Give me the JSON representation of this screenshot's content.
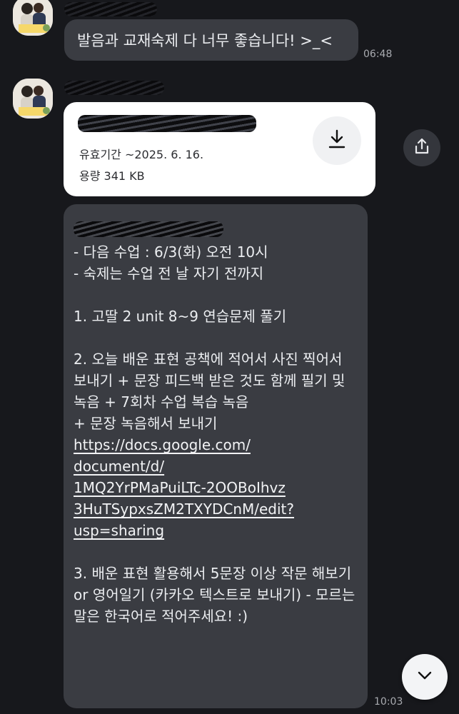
{
  "message1": {
    "text": "발음과 교재숙제 다 너무 좋습니다! >_<",
    "time": "06:48"
  },
  "file_card": {
    "expiry": "유효기간 ~2025. 6. 16.",
    "size": "용량 341 KB",
    "download_icon": "download-icon"
  },
  "share_icon": "share-icon",
  "message2": {
    "lines": [
      "- 다음 수업 : 6/3(화) 오전 10시",
      "- 숙제는 수업 전 날 자기 전까지",
      "",
      "1. 고딸 2 unit 8~9 연습문제 풀기",
      "",
      "2. 오늘 배운 표현 공책에 적어서 사진 찍어서 보내기 + 문장 피드백 받은 것도 함께 필기 및 녹음 + 7회차 수업 복습 녹음",
      "+ 문장 녹음해서 보내기"
    ],
    "link": "https://docs.google.com/document/d/1MQ2YrPMaPuiLTc-2OOBoIhvz3HuTSypxsZM2TXYDCnM/edit?usp=sharing",
    "link_lines": [
      "https://docs.google.com/",
      "document/d/",
      "1MQ2YrPMaPuiLTc-2OOBoIhvz",
      "3HuTSypxsZM2TXYDCnM/edit?",
      "usp=sharing"
    ],
    "item3": "3. 배운 표현 활용해서 5문장 이상 작문 해보기 or 영어일기 (카카오 텍스트로 보내기) - 모르는 말은 한국어로 적어주세요! :)",
    "time": "10:03"
  },
  "scroll_down_icon": "chevron-down-icon"
}
